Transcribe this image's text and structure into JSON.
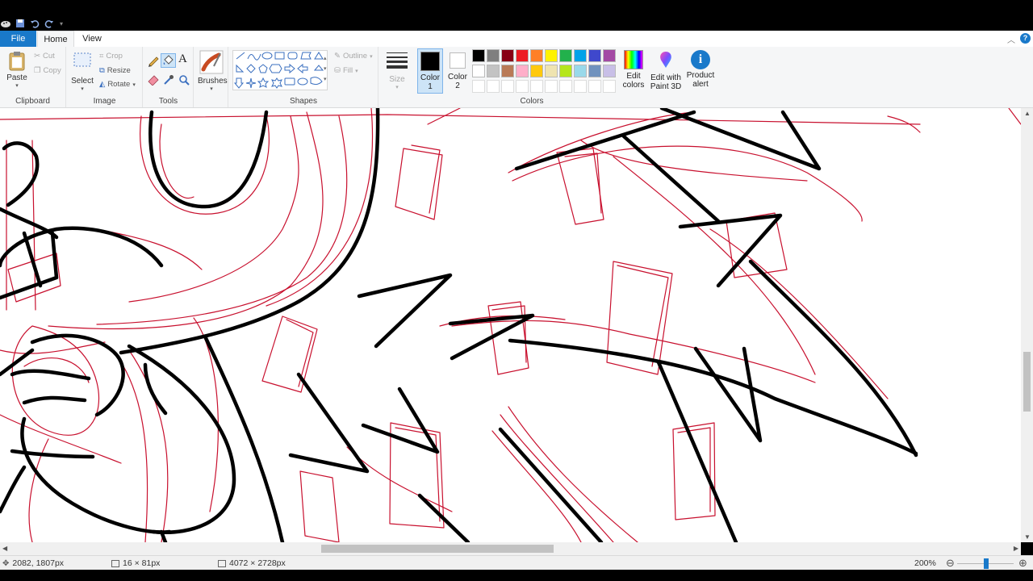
{
  "quick_access": {
    "items": [
      "paint-app-icon",
      "save-icon",
      "undo-icon",
      "redo-icon",
      "customize-icon"
    ]
  },
  "tabs": {
    "file": "File",
    "home": "Home",
    "view": "View"
  },
  "ribbon": {
    "clipboard": {
      "paste": "Paste",
      "cut": "Cut",
      "copy": "Copy",
      "group_label": "Clipboard"
    },
    "image": {
      "select": "Select",
      "crop": "Crop",
      "resize": "Resize",
      "rotate": "Rotate",
      "group_label": "Image"
    },
    "tools": {
      "group_label": "Tools"
    },
    "brushes": {
      "label": "Brushes"
    },
    "shapes": {
      "outline": "Outline",
      "fill": "Fill",
      "group_label": "Shapes"
    },
    "size": {
      "label": "Size"
    },
    "colors": {
      "color1": "Color",
      "color1_num": "1",
      "color2": "Color",
      "color2_num": "2",
      "edit_colors_1": "Edit",
      "edit_colors_2": "colors",
      "paint3d_1": "Edit with",
      "paint3d_2": "Paint 3D",
      "product_alert_1": "Product",
      "product_alert_2": "alert",
      "group_label": "Colors",
      "palette_row1": [
        "#000000",
        "#7f7f7f",
        "#880015",
        "#ed1c24",
        "#ff7f27",
        "#fff200",
        "#22b14c",
        "#00a2e8",
        "#3f48cc",
        "#a349a4"
      ],
      "palette_row2": [
        "#ffffff",
        "#c3c3c3",
        "#b97a57",
        "#ffaec9",
        "#ffc90e",
        "#efe4b0",
        "#b5e61d",
        "#99d9ea",
        "#7092be",
        "#c8bfe7"
      ],
      "primary": "#000000",
      "secondary": "#ffffff"
    }
  },
  "status": {
    "cursor_pos": "2082, 1807px",
    "selection_size": "16 × 81px",
    "image_size": "4072 × 2728px",
    "zoom": "200%"
  },
  "colors": {
    "accent": "#1979ca",
    "sketch_red": "#c8102e",
    "ink": "#000000"
  }
}
